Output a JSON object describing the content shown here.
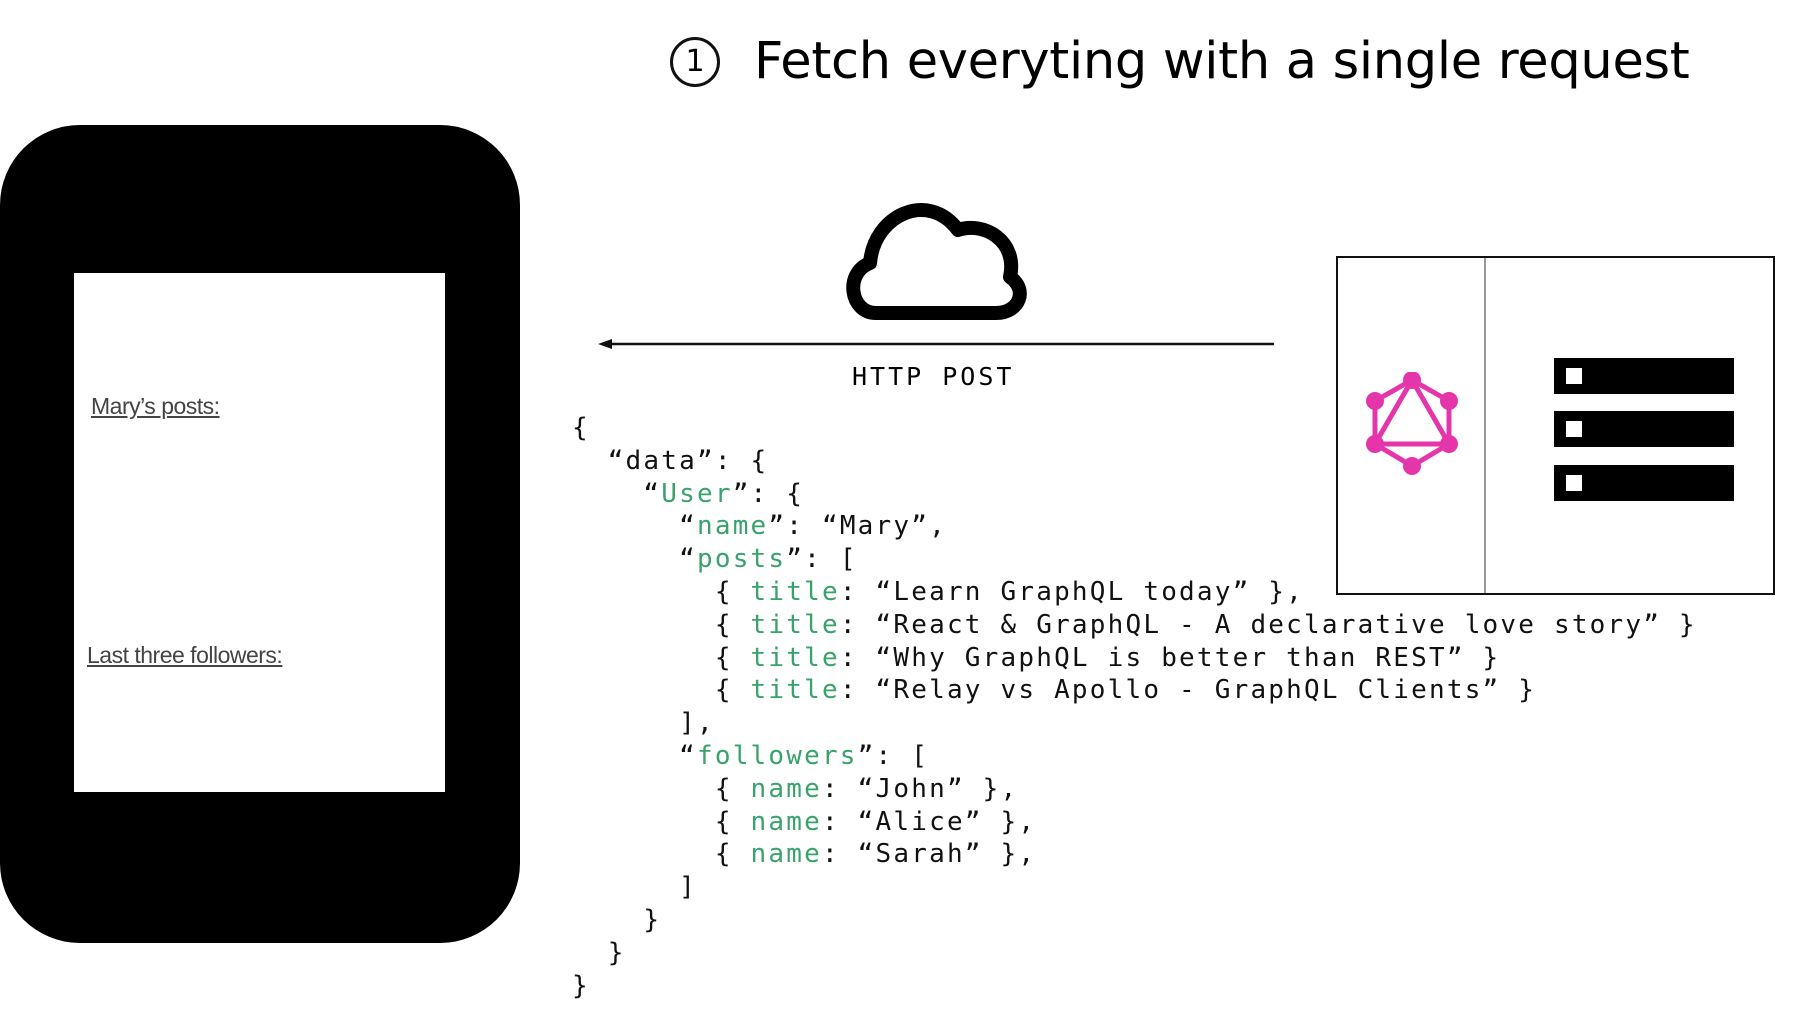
{
  "slide": {
    "step_number": "1",
    "title": "Fetch everyting with a single request"
  },
  "phone": {
    "posts_label": "Mary’s posts:",
    "followers_label": "Last three followers:"
  },
  "transport": {
    "label": "HTTP POST",
    "direction": "server-to-client",
    "icon": "cloud-icon"
  },
  "server": {
    "logo": "graphql-logo-icon",
    "logo_color": "#e535ab",
    "rack_count": 3
  },
  "response": {
    "key_color": "#3aa26b",
    "lines": [
      [
        {
          "t": "{",
          "k": false
        }
      ],
      [
        {
          "t": "  “data”: {",
          "k": false
        }
      ],
      [
        {
          "t": "    “",
          "k": false
        },
        {
          "t": "User",
          "k": true
        },
        {
          "t": "”: {",
          "k": false
        }
      ],
      [
        {
          "t": "      “",
          "k": false
        },
        {
          "t": "name",
          "k": true
        },
        {
          "t": "”: “Mary”,",
          "k": false
        }
      ],
      [
        {
          "t": "      “",
          "k": false
        },
        {
          "t": "posts",
          "k": true
        },
        {
          "t": "”: [",
          "k": false
        }
      ],
      [
        {
          "t": "        { ",
          "k": false
        },
        {
          "t": "title",
          "k": true
        },
        {
          "t": ": “Learn GraphQL today” },",
          "k": false
        }
      ],
      [
        {
          "t": "        { ",
          "k": false
        },
        {
          "t": "title",
          "k": true
        },
        {
          "t": ": “React & GraphQL - A declarative love story” }",
          "k": false
        }
      ],
      [
        {
          "t": "        { ",
          "k": false
        },
        {
          "t": "title",
          "k": true
        },
        {
          "t": ": “Why GraphQL is better than REST” }",
          "k": false
        }
      ],
      [
        {
          "t": "        { ",
          "k": false
        },
        {
          "t": "title",
          "k": true
        },
        {
          "t": ": “Relay vs Apollo - GraphQL Clients” }",
          "k": false
        }
      ],
      [
        {
          "t": "      ],",
          "k": false
        }
      ],
      [
        {
          "t": "      “",
          "k": false
        },
        {
          "t": "followers",
          "k": true
        },
        {
          "t": "”: [",
          "k": false
        }
      ],
      [
        {
          "t": "        { ",
          "k": false
        },
        {
          "t": "name",
          "k": true
        },
        {
          "t": ": “John” },",
          "k": false
        }
      ],
      [
        {
          "t": "        { ",
          "k": false
        },
        {
          "t": "name",
          "k": true
        },
        {
          "t": ": “Alice” },",
          "k": false
        }
      ],
      [
        {
          "t": "        { ",
          "k": false
        },
        {
          "t": "name",
          "k": true
        },
        {
          "t": ": “Sarah” },",
          "k": false
        }
      ],
      [
        {
          "t": "      ]",
          "k": false
        }
      ],
      [
        {
          "t": "    }",
          "k": false
        }
      ],
      [
        {
          "t": "  }",
          "k": false
        }
      ],
      [
        {
          "t": "}",
          "k": false
        }
      ]
    ]
  }
}
